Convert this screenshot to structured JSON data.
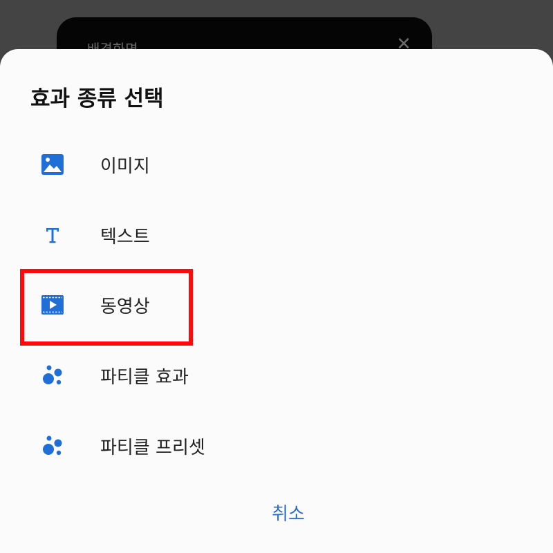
{
  "background_dialog": {
    "title": "배경화면",
    "close_glyph": "✕"
  },
  "sheet": {
    "title": "효과 종류 선택",
    "options": [
      {
        "label": "이미지",
        "icon": "image-icon"
      },
      {
        "label": "텍스트",
        "icon": "text-icon"
      },
      {
        "label": "동영상",
        "icon": "video-icon"
      },
      {
        "label": "파티클 효과",
        "icon": "particle-icon"
      },
      {
        "label": "파티클 프리셋",
        "icon": "particle-icon"
      }
    ],
    "cancel_label": "취소"
  },
  "colors": {
    "accent": "#1f6fd6",
    "highlight": "#ff0a0a",
    "scrim": "#444444"
  }
}
